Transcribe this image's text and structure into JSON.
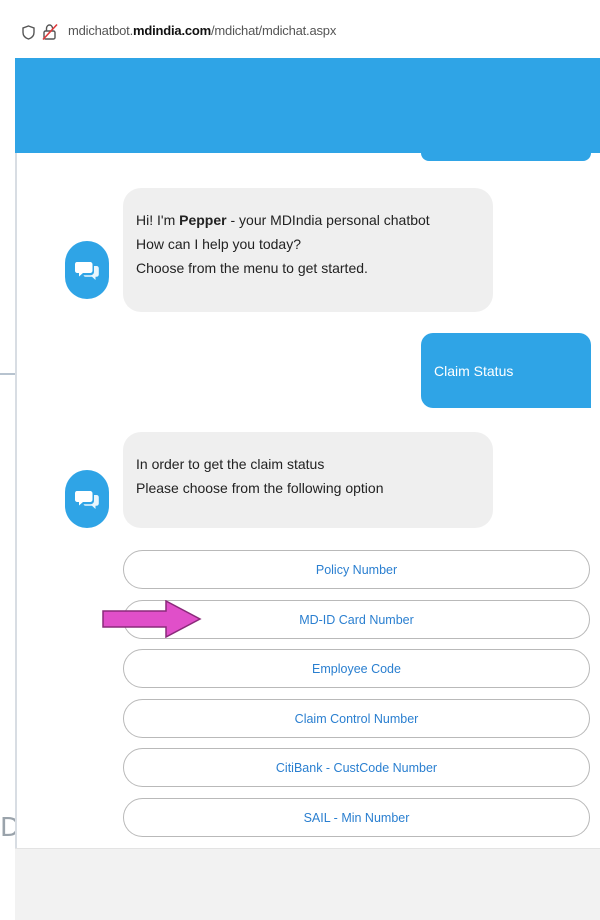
{
  "browser": {
    "url_prefix": "mdichatbot.",
    "url_domain": "mdindia.com",
    "url_path": "/mdichat/mdichat.aspx"
  },
  "chat": {
    "greeting": {
      "line1_pre": "Hi! I'm ",
      "line1_name": "Pepper",
      "line1_post": " - your MDIndia personal chatbot",
      "line2": "How can I help you today?",
      "line3": "Choose from the menu to get started."
    },
    "user_message": "Claim Status",
    "bot_reply": {
      "line1": "In order to get the claim status",
      "line2": "Please choose from the following option"
    },
    "options": [
      "Policy Number",
      "MD-ID Card Number",
      "Employee Code",
      "Claim Control Number",
      "CitiBank - CustCode Number",
      "SAIL - Min Number"
    ]
  },
  "behind_page_text": "D",
  "colors": {
    "accent": "#2fa4e6",
    "bot_bubble": "#efefef",
    "option_text": "#2a7fd0",
    "annotation_arrow": "#e04fc9"
  },
  "icons": {
    "shield": "shield-icon",
    "lock": "insecure-lock-icon",
    "avatar": "chat-bubbles-icon",
    "annotation": "pointer-arrow"
  }
}
